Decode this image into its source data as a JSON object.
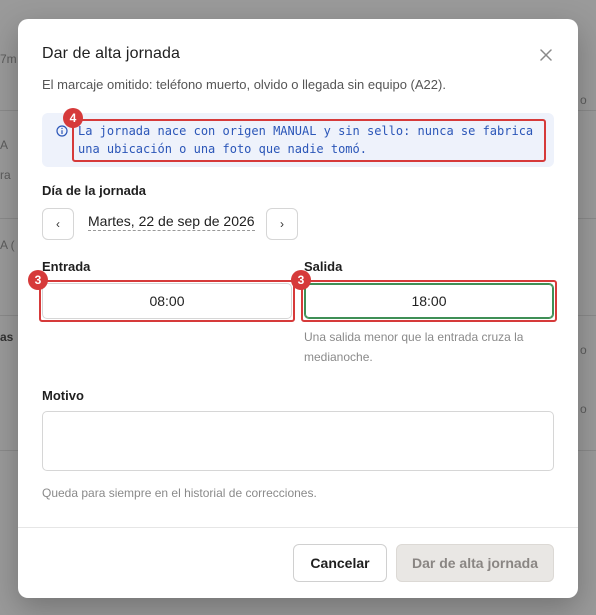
{
  "modal": {
    "title": "Dar de alta jornada",
    "description": "El marcaje omitido: teléfono muerto, olvido o llegada sin equipo (A22).",
    "close_icon": "close-icon"
  },
  "info": {
    "icon": "info-circle-icon",
    "text": "La jornada nace con origen MANUAL y sin sello: nunca se fabrica una ubicación o una foto que nadie tomó."
  },
  "annotations": {
    "info_badge": "4",
    "entrada_badge": "3",
    "salida_badge": "3"
  },
  "day": {
    "label": "Día de la jornada",
    "prev_icon": "chevron-left-icon",
    "next_icon": "chevron-right-icon",
    "prev_label": "‹",
    "next_label": "›",
    "value": "Martes, 22 de sep de 2026"
  },
  "entrada": {
    "label": "Entrada",
    "value": "08:00"
  },
  "salida": {
    "label": "Salida",
    "value": "18:00",
    "hint": "Una salida menor que la entrada cruza la medianoche."
  },
  "motivo": {
    "label": "Motivo",
    "value": "",
    "hint": "Queda para siempre en el historial de correcciones."
  },
  "footer": {
    "cancel_label": "Cancelar",
    "submit_label": "Dar de alta jornada"
  },
  "background": {
    "fragments": [
      "7m",
      "A",
      "ra",
      "A (",
      "as",
      "o",
      "o",
      "o"
    ]
  },
  "colors": {
    "annotation": "#d63a3a",
    "info_text": "#2b56b8",
    "info_bg": "#eef2fb",
    "focus": "#3f8f56"
  }
}
